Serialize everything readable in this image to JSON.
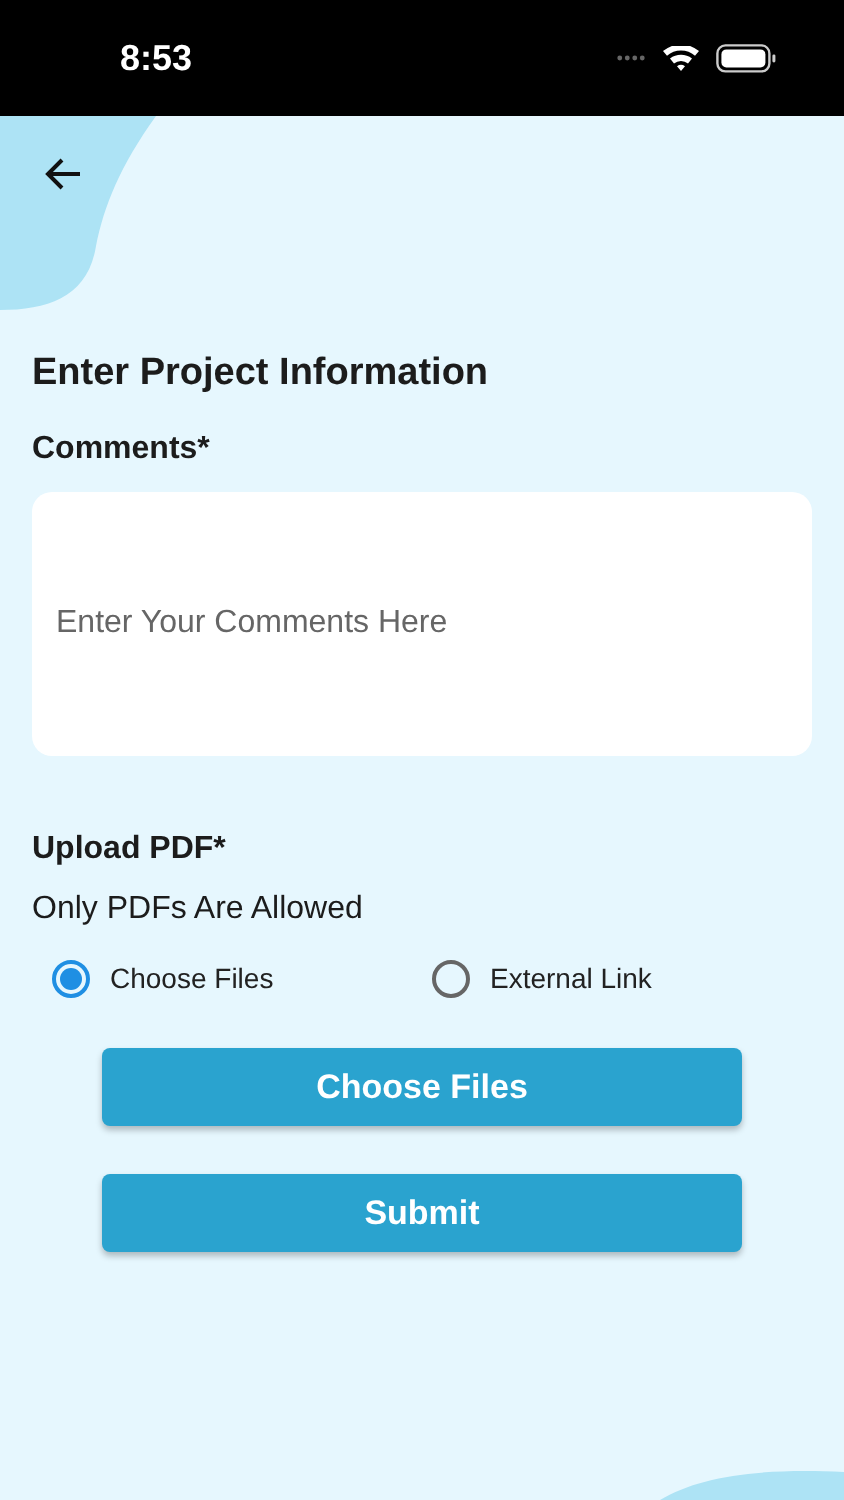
{
  "status_bar": {
    "time": "8:53"
  },
  "heading": "Enter Project Information",
  "comments": {
    "label": "Comments*",
    "placeholder": "Enter Your Comments Here"
  },
  "upload": {
    "label": "Upload PDF*",
    "hint": "Only PDFs Are Allowed",
    "options": [
      {
        "label": "Choose Files",
        "selected": true
      },
      {
        "label": "External Link",
        "selected": false
      }
    ]
  },
  "buttons": [
    "Choose Files",
    "Submit"
  ]
}
